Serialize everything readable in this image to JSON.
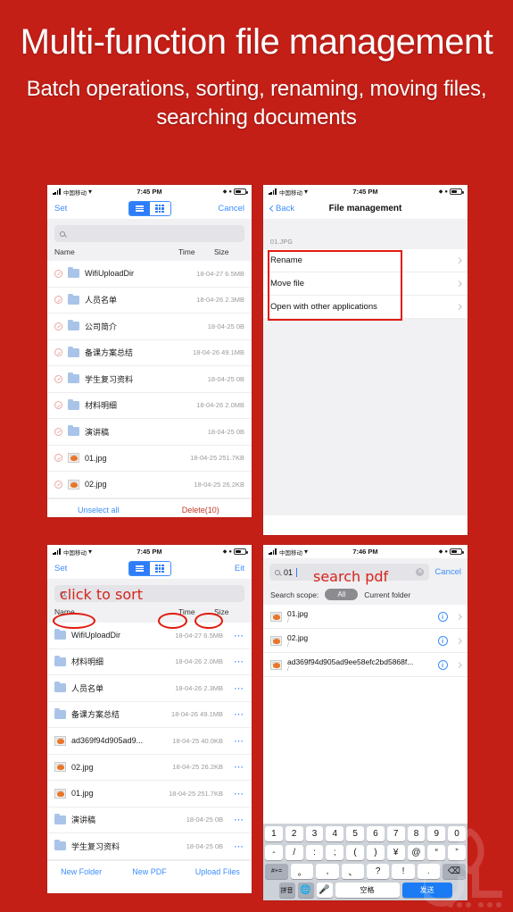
{
  "hero": {
    "title": "Multi-function file management",
    "subtitle": "Batch operations, sorting, renaming, moving files, searching documents",
    "background_color": "#c41f17",
    "text_color": "#ffffff"
  },
  "colors": {
    "brand_red": "#c41f17",
    "annotation_red": "#e01b0f",
    "ios_blue": "#3c8dfc",
    "danger_red": "#c0392b",
    "folder_blue": "#a9c4e8"
  },
  "status_bar": {
    "carrier": "中国移动",
    "time_745": "7:45 PM",
    "time_746": "7:46 PM",
    "signal_icon": "signal-bars-icon",
    "wifi_icon": "wifi-icon",
    "battery_icon": "battery-icon"
  },
  "panel_select": {
    "nav": {
      "left_label": "Set",
      "right_label": "Cancel",
      "segment_list_icon": "list-view-icon",
      "segment_grid_icon": "grid-view-icon"
    },
    "search_placeholder": "",
    "columns": {
      "name": "Name",
      "time": "Time",
      "size": "Size"
    },
    "rows": [
      {
        "name": "WifiUploadDir",
        "meta": "18-04-27 6.5MB",
        "icon": "folder-icon",
        "selected": true
      },
      {
        "name": "人员名单",
        "meta": "18-04-26 2.3MB",
        "icon": "folder-icon",
        "selected": true
      },
      {
        "name": "公司简介",
        "meta": "18-04-25 0B",
        "icon": "folder-icon",
        "selected": true
      },
      {
        "name": "备课方案总结",
        "meta": "18-04-26 49.1MB",
        "icon": "folder-icon",
        "selected": true
      },
      {
        "name": "学生复习资料",
        "meta": "18-04-25 0B",
        "icon": "folder-icon",
        "selected": true
      },
      {
        "name": "材料明细",
        "meta": "18-04-26 2.0MB",
        "icon": "folder-icon",
        "selected": true
      },
      {
        "name": "演讲稿",
        "meta": "18-04-25 0B",
        "icon": "folder-icon",
        "selected": true
      },
      {
        "name": "01.jpg",
        "meta": "18-04-25 251.7KB",
        "icon": "image-icon",
        "selected": true
      },
      {
        "name": "02.jpg",
        "meta": "18-04-25 26.2KB",
        "icon": "image-icon",
        "selected": true
      }
    ],
    "footer": {
      "unselect_all": "Unselect all",
      "delete": "Delete(10)"
    }
  },
  "panel_menu": {
    "nav": {
      "back_label": "Back",
      "title": "File management"
    },
    "group_header": "01.JPG",
    "items": [
      {
        "label": "Rename"
      },
      {
        "label": "Move file"
      },
      {
        "label": "Open with other applications"
      }
    ]
  },
  "panel_sort": {
    "nav": {
      "left_label": "Set",
      "right_label": "Eit",
      "segment_list_icon": "list-view-icon",
      "segment_grid_icon": "grid-view-icon"
    },
    "annotation": "click to sort",
    "columns": {
      "name": "Name",
      "time": "Time",
      "size": "Size"
    },
    "rows": [
      {
        "name": "WifiUploadDir",
        "meta": "18-04-27 6.5MB",
        "icon": "folder-icon"
      },
      {
        "name": "材料明细",
        "meta": "18-04-26 2.0MB",
        "icon": "folder-icon"
      },
      {
        "name": "人员名单",
        "meta": "18-04-26 2.3MB",
        "icon": "folder-icon"
      },
      {
        "name": "备课方案总结",
        "meta": "18-04-26 49.1MB",
        "icon": "folder-icon"
      },
      {
        "name": "ad369f94d905ad9...",
        "meta": "18-04-25 40.0KB",
        "icon": "image-icon"
      },
      {
        "name": "02.jpg",
        "meta": "18-04-25 26.2KB",
        "icon": "image-icon"
      },
      {
        "name": "01.jpg",
        "meta": "18-04-25 251.7KB",
        "icon": "image-icon"
      },
      {
        "name": "演讲稿",
        "meta": "18-04-25 0B",
        "icon": "folder-icon"
      },
      {
        "name": "学生复习资料",
        "meta": "18-04-25 0B",
        "icon": "folder-icon"
      }
    ],
    "row_more_icon": "more-dots-icon",
    "footer": {
      "new_folder": "New Folder",
      "new_pdf": "New PDF",
      "upload_files": "Upload Files"
    }
  },
  "panel_search": {
    "search_value": "01",
    "cancel_label": "Cancel",
    "clear_icon": "clear-circle-icon",
    "annotation": "search pdf",
    "scope_label": "Search scope:",
    "scope_selected": "All",
    "scope_other": "Current folder",
    "results": [
      {
        "name": "01.jpg",
        "path": "/",
        "icon": "image-icon",
        "info_icon": "info-icon"
      },
      {
        "name": "02.jpg",
        "path": "/",
        "icon": "image-icon",
        "info_icon": "info-icon"
      },
      {
        "name": "ad369f94d905ad9ee58efc2bd5868f...",
        "path": "/",
        "icon": "image-icon",
        "info_icon": "info-icon"
      }
    ],
    "keyboard": {
      "row1": [
        "1",
        "2",
        "3",
        "4",
        "5",
        "6",
        "7",
        "8",
        "9",
        "0"
      ],
      "row2": [
        "-",
        "/",
        ":",
        ";",
        "(",
        ")",
        "¥",
        "@",
        "“",
        "”"
      ],
      "row3": [
        "#+=",
        "。",
        ",",
        "、",
        "?",
        "!",
        "."
      ],
      "row3_backspace_icon": "backspace-icon",
      "row4_pinyin": "拼音",
      "row4_globe_icon": "globe-icon",
      "row4_mic_icon": "microphone-icon",
      "row4_space": "空格",
      "row4_send": "发送"
    }
  }
}
